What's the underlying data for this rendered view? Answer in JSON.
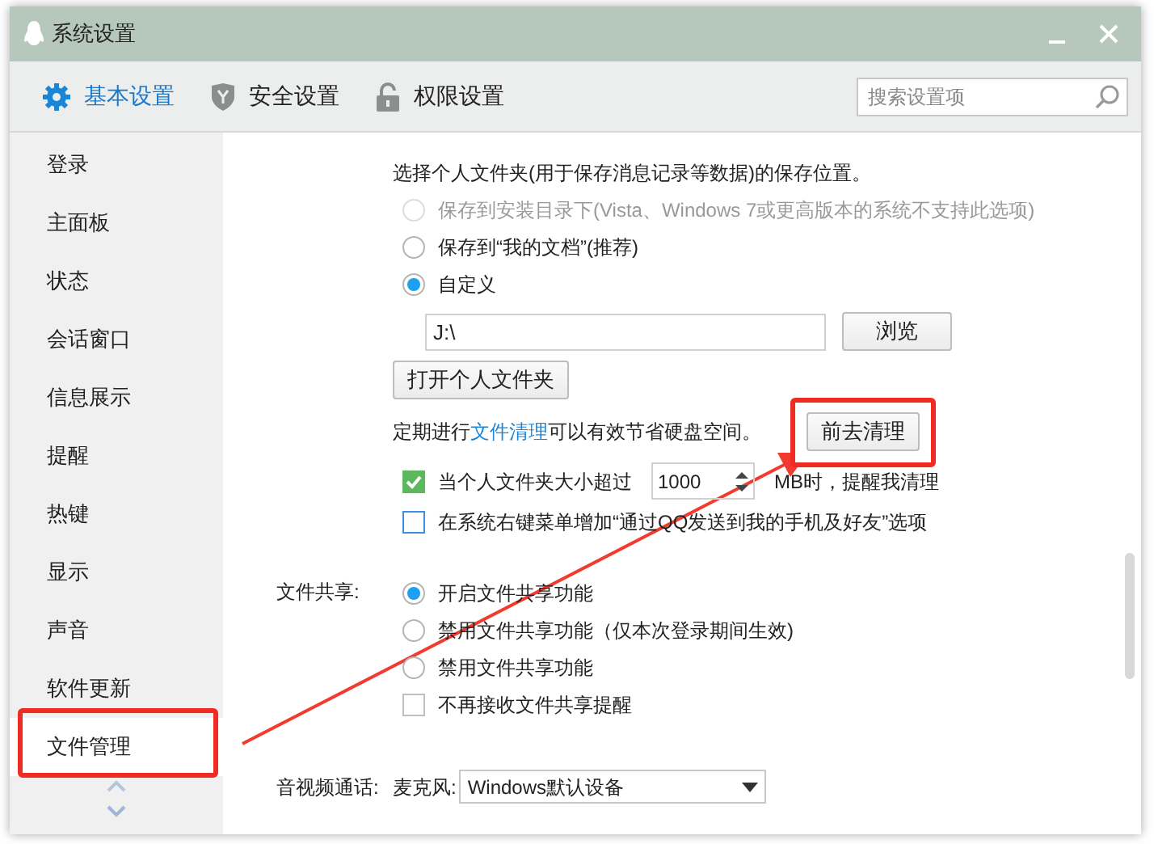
{
  "window": {
    "title": "系统设置"
  },
  "toolbar": {
    "tabs": [
      {
        "label": "基本设置",
        "selected": true,
        "kind": "gear"
      },
      {
        "label": "安全设置",
        "selected": false,
        "kind": "shield"
      },
      {
        "label": "权限设置",
        "selected": false,
        "kind": "lock"
      }
    ],
    "search": {
      "placeholder": "搜索设置项"
    }
  },
  "sidebar": {
    "items": [
      {
        "label": "登录",
        "selected": false
      },
      {
        "label": "主面板",
        "selected": false
      },
      {
        "label": "状态",
        "selected": false
      },
      {
        "label": "会话窗口",
        "selected": false
      },
      {
        "label": "信息展示",
        "selected": false
      },
      {
        "label": "提醒",
        "selected": false
      },
      {
        "label": "热键",
        "selected": false
      },
      {
        "label": "显示",
        "selected": false
      },
      {
        "label": "声音",
        "selected": false
      },
      {
        "label": "软件更新",
        "selected": false
      },
      {
        "label": "文件管理",
        "selected": true
      }
    ]
  },
  "storage": {
    "heading": "选择个人文件夹(用于保存消息记录等数据)的保存位置。",
    "options": [
      {
        "label": "保存到安装目录下(Vista、Windows 7或更高版本的系统不支持此选项)",
        "selected": false,
        "disabled": true
      },
      {
        "label": "保存到“我的文档”(推荐)",
        "selected": false,
        "disabled": false
      },
      {
        "label": "自定义",
        "selected": true,
        "disabled": false
      }
    ],
    "path": "J:\\",
    "browse_button": "浏览",
    "open_button": "打开个人文件夹",
    "cleanup": {
      "before": "定期进行",
      "link": "文件清理",
      "after": "可以有效节省硬盘空间。",
      "button": "前去清理"
    },
    "checks": [
      {
        "kind": "size",
        "before": "当个人文件夹大小超过",
        "value": "1000",
        "after": "MB时，提醒我清理",
        "checked": true
      },
      {
        "kind": "plain",
        "label": "在系统右键菜单增加“通过QQ发送到我的手机及好友”选项",
        "checked": false
      }
    ]
  },
  "sharing": {
    "label": "文件共享:",
    "options": [
      {
        "label": "开启文件共享功能",
        "selected": true
      },
      {
        "label": "禁用文件共享功能（仅本次登录期间生效)",
        "selected": false
      },
      {
        "label": "禁用文件共享功能",
        "selected": false
      }
    ],
    "checks": [
      {
        "label": "不再接收文件共享提醒",
        "checked": false
      }
    ]
  },
  "av": {
    "label": "音视频通话:",
    "mic_label": "麦克风:",
    "mic_value": "Windows默认设备"
  }
}
